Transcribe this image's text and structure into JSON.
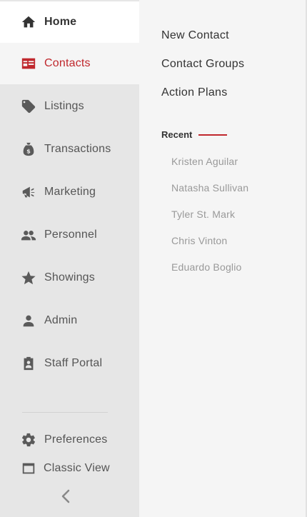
{
  "sidebar": {
    "items": [
      {
        "label": "Home",
        "icon": "home-icon"
      },
      {
        "label": "Contacts",
        "icon": "contact-card-icon"
      },
      {
        "label": "Listings",
        "icon": "tag-icon"
      },
      {
        "label": "Transactions",
        "icon": "money-bag-icon"
      },
      {
        "label": "Marketing",
        "icon": "megaphone-icon"
      },
      {
        "label": "Personnel",
        "icon": "people-icon"
      },
      {
        "label": "Showings",
        "icon": "star-icon"
      },
      {
        "label": "Admin",
        "icon": "person-icon"
      },
      {
        "label": "Staff Portal",
        "icon": "clipboard-person-icon"
      }
    ],
    "bottom": [
      {
        "label": "Preferences",
        "icon": "gear-icon"
      },
      {
        "label": "Classic View",
        "icon": "window-icon"
      }
    ],
    "collapse_icon": "chevron-left-icon",
    "active_item": "Contacts"
  },
  "submenu": {
    "links": [
      "New Contact",
      "Contact Groups",
      "Action Plans"
    ],
    "recent_title": "Recent",
    "recent": [
      "Kristen Aguilar",
      "Natasha Sullivan",
      "Tyler St. Mark",
      "Chris Vinton",
      "Eduardo Boglio"
    ]
  },
  "colors": {
    "accent": "#c0282d",
    "sidebar_bg": "#e6e6e6",
    "panel_bg": "#f5f5f5"
  }
}
